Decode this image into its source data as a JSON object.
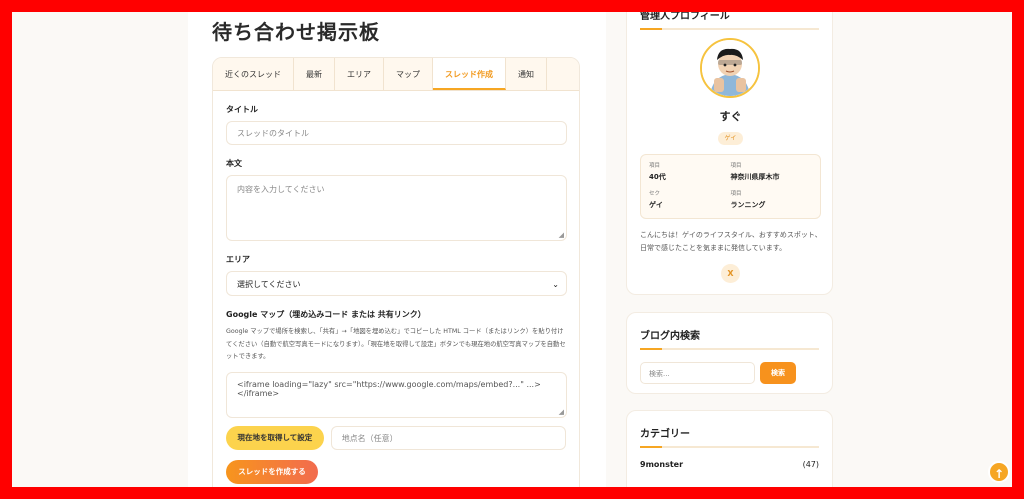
{
  "page": {
    "title": "待ち合わせ掲示板"
  },
  "tabs": [
    {
      "label": "近くのスレッド"
    },
    {
      "label": "最新"
    },
    {
      "label": "エリア"
    },
    {
      "label": "マップ"
    },
    {
      "label": "スレッド作成"
    },
    {
      "label": "通知"
    }
  ],
  "active_tab": "スレッド作成",
  "form": {
    "title_label": "タイトル",
    "title_placeholder": "スレッドのタイトル",
    "body_label": "本文",
    "body_placeholder": "内容を入力してください",
    "area_label": "エリア",
    "area_value": "選択してください",
    "map_label": "Google マップ（埋め込みコード または 共有リンク）",
    "map_help": "Google マップで場所を検索し、「共有」→「地図を埋め込む」でコピーした HTML コード（またはリンク）を貼り付けてください（自動で航空写真モードになります）。「現在地を取得して設定」ボタンでも現在地の航空写真マップを自動セットできます。",
    "map_placeholder": "<iframe loading=\"lazy\" src=\"https://www.google.com/maps/embed?...\" ...></iframe>",
    "locate_button": "現在地を取得して設定",
    "place_placeholder": "地点名（任意）",
    "submit_button": "スレッドを作成する"
  },
  "profile": {
    "heading": "管理人プロフィール",
    "name": "すぐ",
    "badge": "ゲイ",
    "info": [
      {
        "key": "項目",
        "value": "40代"
      },
      {
        "key": "項目",
        "value": "神奈川県厚木市"
      },
      {
        "key": "セク",
        "value": "ゲイ"
      },
      {
        "key": "項目",
        "value": "ランニング"
      }
    ],
    "bio": "こんにちは！ゲイのライフスタイル、おすすめスポット、日常で感じたことを気ままに発信しています。",
    "x_label": "X"
  },
  "search": {
    "heading": "ブログ内検索",
    "placeholder": "検索...",
    "button": "検索"
  },
  "categories": {
    "heading": "カテゴリー",
    "items": [
      {
        "name": "9monster",
        "count": "(47)"
      }
    ]
  },
  "colors": {
    "accent": "#f6a623",
    "frame": "#ff0000"
  },
  "icons": {
    "scroll_top": "arrow-up-icon"
  }
}
